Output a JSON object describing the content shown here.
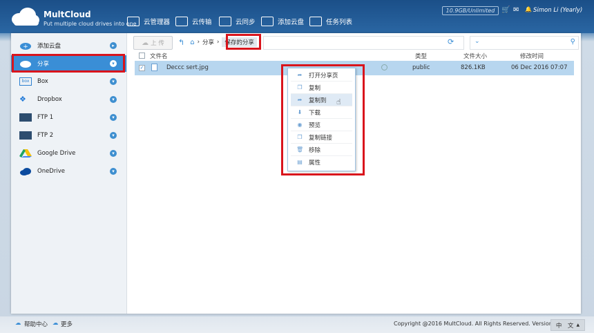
{
  "brand": {
    "name": "MultCloud",
    "tagline": "Put multiple cloud drives into one"
  },
  "top_nav": [
    {
      "label": "云管理器",
      "icon": "cloud-manager-icon"
    },
    {
      "label": "云传输",
      "icon": "transfer-icon"
    },
    {
      "label": "云同步",
      "icon": "sync-icon"
    },
    {
      "label": "添加云盘",
      "icon": "add-cloud-icon"
    },
    {
      "label": "任务列表",
      "icon": "task-list-icon"
    }
  ],
  "header": {
    "quota": "10.9GB/Unlimited",
    "user": "Simon Li (Yearly)"
  },
  "sidebar": {
    "items": [
      {
        "label": "添加云盘"
      },
      {
        "label": "分享"
      },
      {
        "label": "Box"
      },
      {
        "label": "Dropbox"
      },
      {
        "label": "FTP 1"
      },
      {
        "label": "FTP 2"
      },
      {
        "label": "Google Drive"
      },
      {
        "label": "OneDrive"
      }
    ]
  },
  "toolbar": {
    "upload_label": "上 传",
    "crumb_share": "分享",
    "crumb_current": "保存的分享"
  },
  "columns": {
    "name": "文件名",
    "type": "类型",
    "size": "文件大小",
    "modified": "修改时间"
  },
  "file": {
    "name": "Deccc sert.jpg",
    "type": "public",
    "size": "826.1KB",
    "modified": "06 Dec 2016 07:07"
  },
  "context_menu": {
    "items": [
      {
        "label": "打开分享页",
        "icon": "share-arrow-icon"
      },
      {
        "label": "复制",
        "icon": "copy-icon"
      },
      {
        "label": "复制到",
        "icon": "copy-to-icon"
      },
      {
        "label": "下载",
        "icon": "download-icon"
      },
      {
        "label": "预览",
        "icon": "eye-icon"
      },
      {
        "label": "复制链接",
        "icon": "link-icon"
      },
      {
        "label": "移除",
        "icon": "trash-icon"
      },
      {
        "label": "属性",
        "icon": "properties-icon"
      }
    ]
  },
  "footer": {
    "help": "帮助中心",
    "more": "更多",
    "copyright": "Copyright @2016 MultCloud. All Rights Reserved. Version 4.0.0",
    "language": "中　文"
  },
  "colors": {
    "accent": "#3a8ed6",
    "highlight_box": "#d9141c",
    "header": "#1f5a96"
  }
}
